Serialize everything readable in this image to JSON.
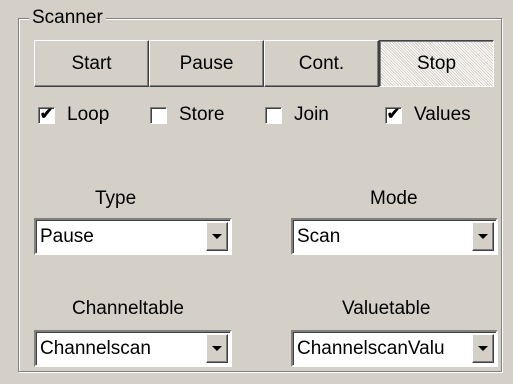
{
  "group": {
    "title": "Scanner"
  },
  "buttons": [
    {
      "label": "Start",
      "pressed": false
    },
    {
      "label": "Pause",
      "pressed": false
    },
    {
      "label": "Cont.",
      "pressed": false
    },
    {
      "label": "Stop",
      "pressed": true
    }
  ],
  "checkboxes": [
    {
      "label": "Loop",
      "checked": true
    },
    {
      "label": "Store",
      "checked": false
    },
    {
      "label": "Join",
      "checked": false
    },
    {
      "label": "Values",
      "checked": true
    }
  ],
  "type": {
    "label": "Type",
    "value": "Pause"
  },
  "mode": {
    "label": "Mode",
    "value": "Scan"
  },
  "channeltable": {
    "label": "Channeltable",
    "value": "Channelscan"
  },
  "valuetable": {
    "label": "Valuetable",
    "value": "ChannelscanValu"
  }
}
